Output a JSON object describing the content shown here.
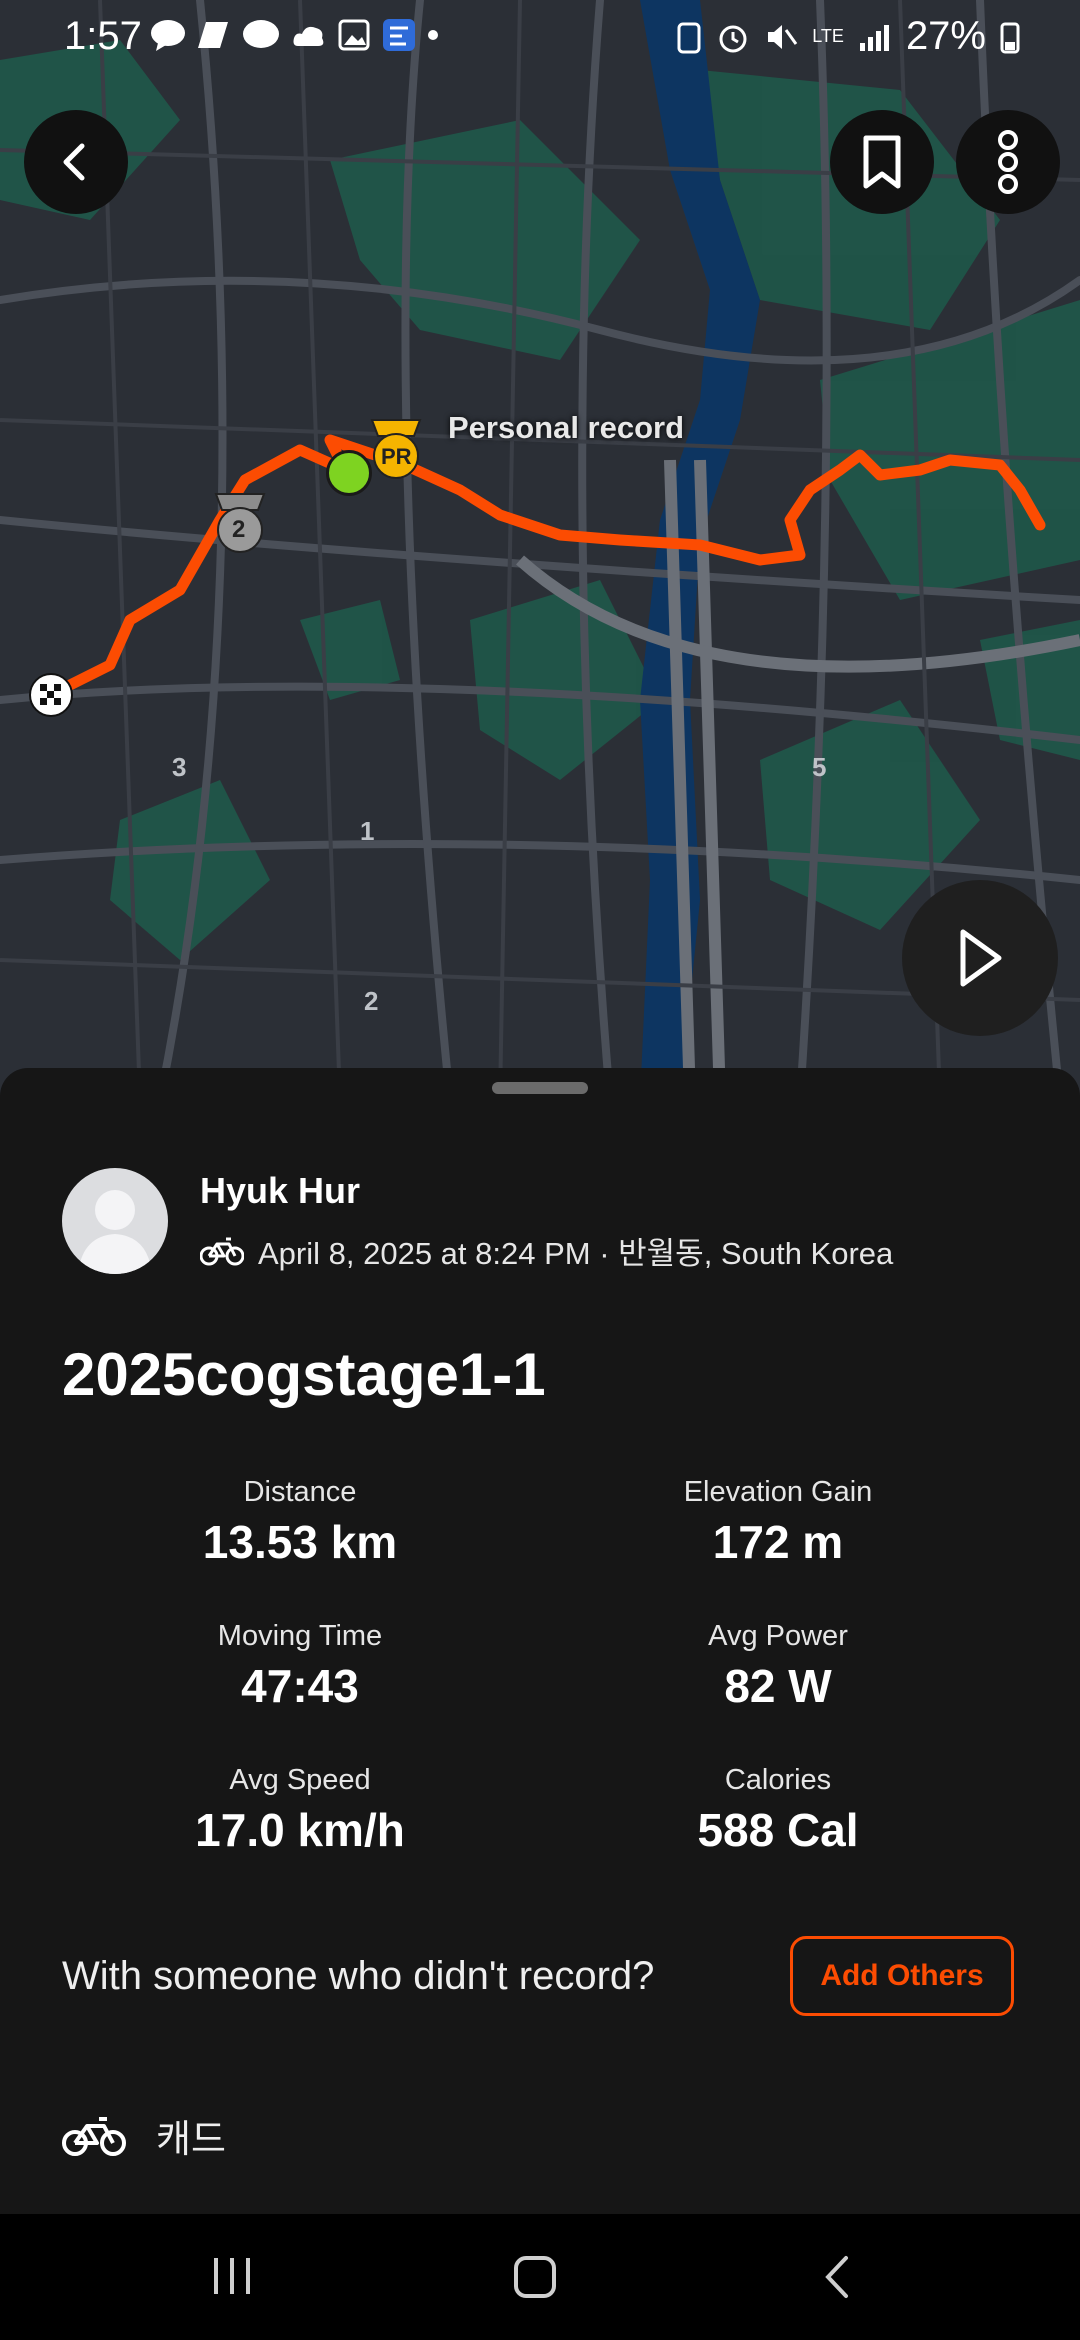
{
  "status_bar": {
    "time": "1:57",
    "battery": "27%",
    "network": "LTE"
  },
  "map": {
    "pr_label": "Personal record",
    "pr_badge": "PR",
    "second_badge": "2",
    "km_markers": [
      "3",
      "1",
      "2",
      "5"
    ],
    "route_color": "#fc4c02"
  },
  "athlete": {
    "name": "Hyuk Hur",
    "activity_meta": "April 8, 2025 at 8:24 PM · 반월동, South Korea"
  },
  "activity": {
    "title": "2025cogstage1-1",
    "stats": [
      {
        "label": "Distance",
        "value": "13.53 km"
      },
      {
        "label": "Elevation Gain",
        "value": "172 m"
      },
      {
        "label": "Moving Time",
        "value": "47:43"
      },
      {
        "label": "Avg Power",
        "value": "82 W"
      },
      {
        "label": "Avg Speed",
        "value": "17.0 km/h"
      },
      {
        "label": "Calories",
        "value": "588 Cal"
      }
    ]
  },
  "tag_others": {
    "prompt": "With someone who didn't record?",
    "button_label": "Add Others"
  },
  "gear": {
    "name": "캐드"
  },
  "icons": {
    "back": "back-arrow-icon",
    "bookmark": "bookmark-icon",
    "more": "more-vertical-icon",
    "play": "play-icon",
    "bike": "bike-icon"
  },
  "colors": {
    "accent": "#fc4c02",
    "start_marker": "#7ed321",
    "pr_gold": "#f5b400"
  }
}
